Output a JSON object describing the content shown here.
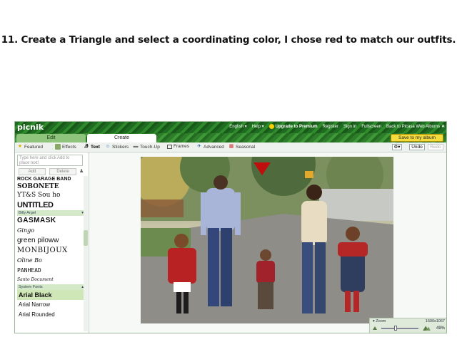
{
  "caption": "11. Create a Triangle and select a coordinating color, I chose red to match our outfits.",
  "app": {
    "logo": "picnik",
    "top_links": {
      "language": "English ▾",
      "help": "Help ▾",
      "upgrade": "Upgrade to Premium",
      "register": "Register",
      "sign_in": "Sign in",
      "fullscreen": "Fullscreen",
      "back": "Back to Picasa Web Albums"
    },
    "tabs": {
      "edit": "Edit",
      "create": "Create"
    },
    "save_label": "Save to my album",
    "toolbar": {
      "featured": "Featured",
      "effects": "Effects",
      "text": "Text",
      "stickers": "Stickers",
      "touchup": "Touch-Up",
      "frames": "Frames",
      "advanced": "Advanced",
      "seasonal": "Seasonal",
      "settings": "⚙▾",
      "undo": "Undo",
      "redo": "Redo"
    },
    "sidebar": {
      "search_placeholder": "Type here and click Add to place text!",
      "add_label": "Add",
      "delete_label": "Delete",
      "fonts_top": [
        "ROCK GARAGE BAND",
        "SOBONETE",
        "YT&S Sou ho",
        "UNTITLED"
      ],
      "group_billy": "Billy Argel",
      "fonts_billy": [
        "GASMASK",
        "Gingo",
        "green piloww",
        "MONBIJOUX",
        "Oline Bo",
        "PANHEAD",
        "Santo Document"
      ],
      "group_system": "System Fonts",
      "fonts_system": [
        "Arial Black",
        "Arial Narrow",
        "Arial Rounded"
      ]
    },
    "canvas": {
      "zoom_label": "Zoom",
      "dimensions": "1600x1067",
      "zoom_percent": "49%",
      "triangle_color": "#c00d0d"
    }
  }
}
